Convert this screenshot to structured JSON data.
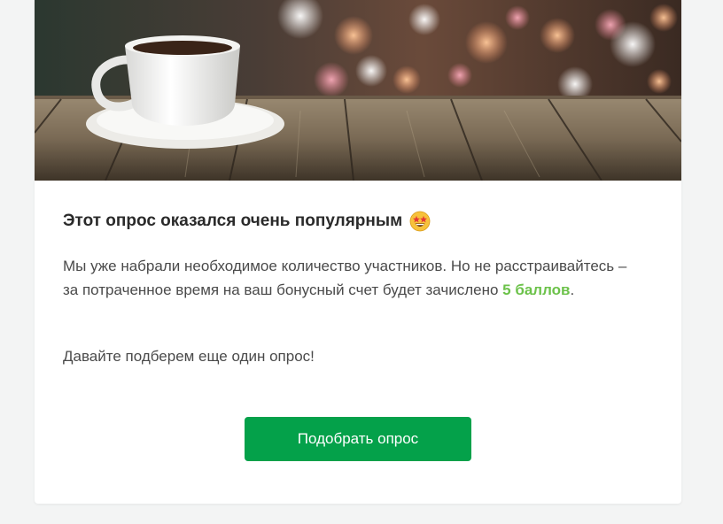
{
  "card": {
    "title": "Этот опрос оказался очень популярным",
    "title_emoji": "star-struck-emoji",
    "paragraph1": {
      "text_before": "Мы уже набрали необходимое количество участников. Но не расстраивайтесь – за потраченное время на ваш бонусный счет будет зачислено ",
      "points": "5 баллов",
      "text_after": "."
    },
    "paragraph2": "Давайте подберем еще один опрос!",
    "button_label": "Подобрать опрос"
  },
  "colors": {
    "accent_green": "#04a14a",
    "points_green": "#6cc24a",
    "background": "#f3f4f4"
  }
}
